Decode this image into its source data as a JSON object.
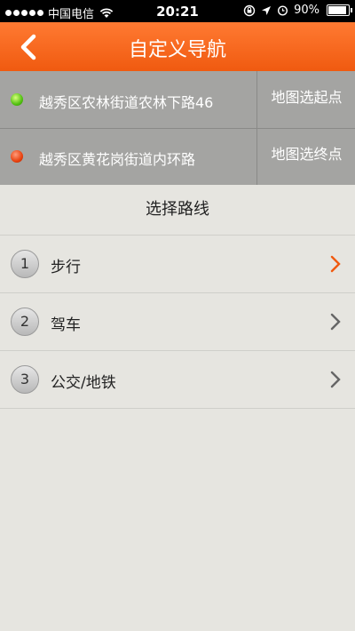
{
  "status_bar": {
    "carrier": "中国电信",
    "time": "20:21",
    "battery_percent": "90%",
    "battery_level": 0.9
  },
  "nav": {
    "title": "自定义导航"
  },
  "route": {
    "start": {
      "address": "越秀区农林街道农林下路46",
      "map_pick_label": "地图选起点"
    },
    "end": {
      "address": "越秀区黄花岗街道内环路",
      "map_pick_label": "地图选终点"
    }
  },
  "section_title": "选择路线",
  "options": [
    {
      "number": "1",
      "label": "步行",
      "active": true
    },
    {
      "number": "2",
      "label": "驾车",
      "active": false
    },
    {
      "number": "3",
      "label": "公交/地铁",
      "active": false
    }
  ],
  "colors": {
    "accent": "#f05a10",
    "chevron_default": "#666666",
    "start_dot": "#52c012",
    "end_dot": "#e8420f"
  }
}
